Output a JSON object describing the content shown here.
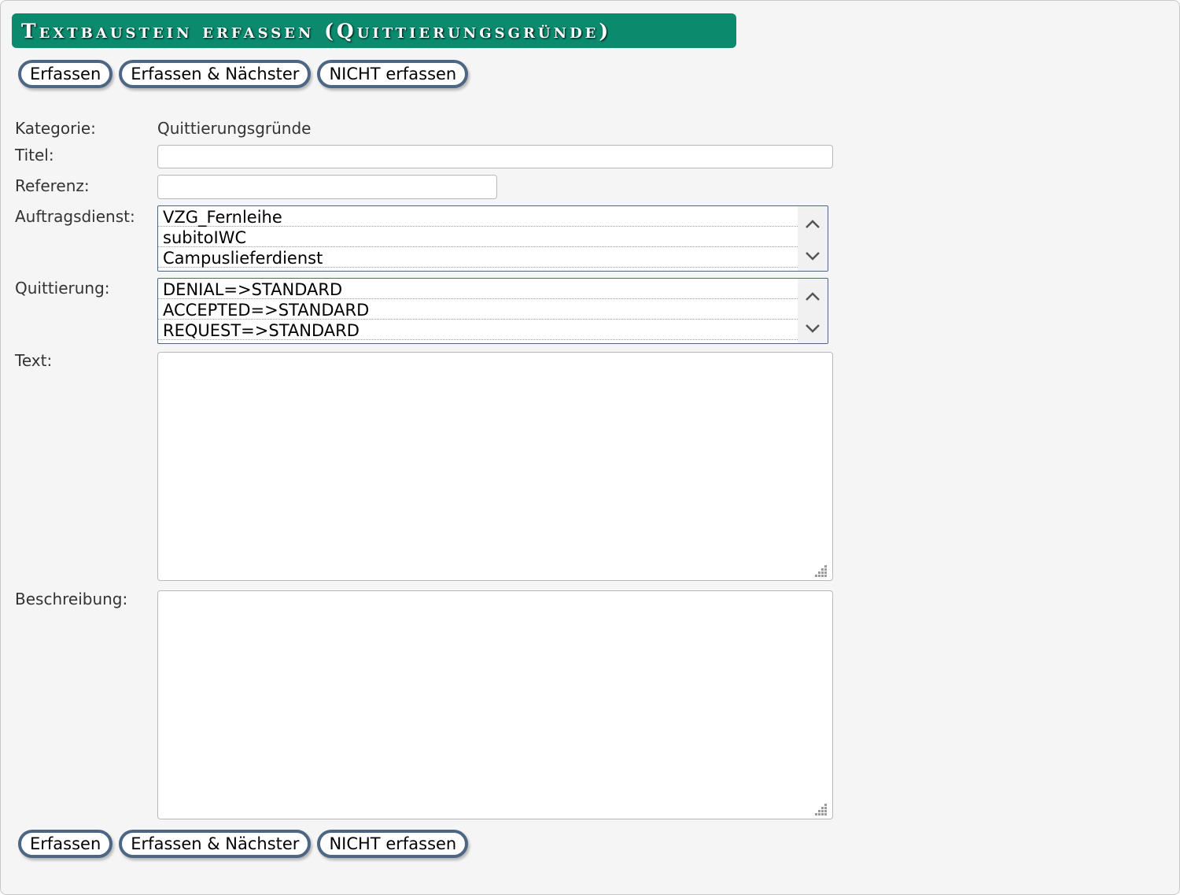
{
  "header": {
    "title": "Textbaustein erfassen (Quittierungsgründe)"
  },
  "top_buttons": {
    "submit": "Erfassen",
    "submit_next": "Erfassen & Nächster",
    "cancel": "NICHT erfassen"
  },
  "form": {
    "kategorie": {
      "label": "Kategorie:",
      "value": "Quittierungsgründe"
    },
    "titel": {
      "label": "Titel:",
      "value": ""
    },
    "referenz": {
      "label": "Referenz:",
      "value": ""
    },
    "auftragsdienst": {
      "label": "Auftragsdienst:",
      "options": [
        "VZG_Fernleihe",
        "subitoIWC",
        "Campuslieferdienst"
      ]
    },
    "quittierung": {
      "label": "Quittierung:",
      "options": [
        "DENIAL=>STANDARD",
        "ACCEPTED=>STANDARD",
        "REQUEST=>STANDARD"
      ]
    },
    "text": {
      "label": "Text:",
      "value": ""
    },
    "beschreibung": {
      "label": "Beschreibung:",
      "value": ""
    }
  },
  "bottom_buttons": {
    "submit": "Erfassen",
    "submit_next": "Erfassen & Nächster",
    "cancel": "NICHT erfassen"
  },
  "icons": {
    "scroll_up": "chevron-up-icon",
    "scroll_down": "chevron-down-icon",
    "resize": "resize-grip-icon"
  },
  "colors": {
    "title_bar": "#0b8a6e",
    "button_border": "#4c6684",
    "background": "#f5f5f5"
  }
}
